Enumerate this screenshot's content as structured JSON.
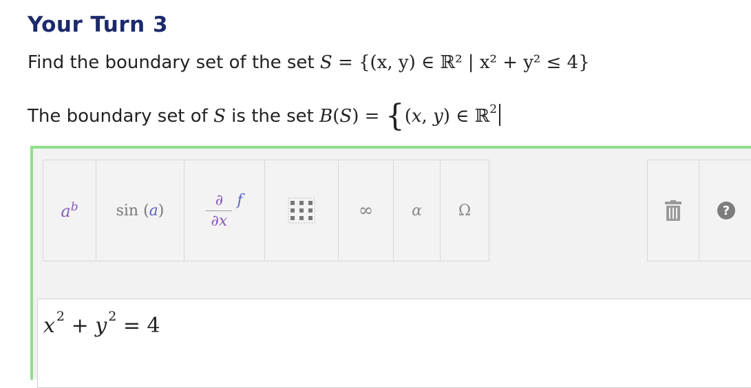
{
  "heading": "Your Turn 3",
  "question": {
    "prefix": "Find the boundary set of the set",
    "math": "{(x, y) ∈ ℝ² | x² + y² ≤ 4}"
  },
  "answer_line": {
    "prefix": "The boundary set of",
    "mid": "is the set"
  },
  "toolbar": {
    "buttons": [
      "superscript",
      "sin (a)",
      "derivative",
      "matrix",
      "∞",
      "α",
      "Ω"
    ],
    "sin_label": "sin",
    "sin_arg": "a",
    "infinity": "∞",
    "alpha": "α",
    "omega": "Ω",
    "help": "?"
  },
  "input": {
    "x": "x",
    "plus": "+",
    "y": "y",
    "exp1": "2",
    "exp2": "2",
    "rhs": "= 4"
  },
  "colors": {
    "heading": "#1c2a6b",
    "editor_border": "#8fe08a",
    "purple": "#8a5ab8",
    "blue": "#5a63c8"
  }
}
